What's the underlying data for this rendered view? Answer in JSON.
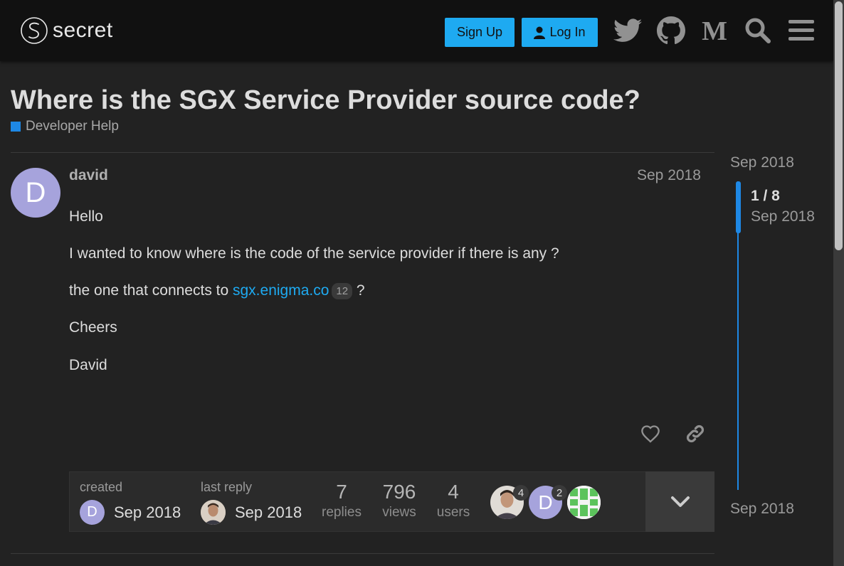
{
  "header": {
    "logo_text": "secret",
    "signup_label": "Sign Up",
    "login_label": "Log In",
    "icons": [
      "twitter-icon",
      "github-icon",
      "medium-icon",
      "search-icon",
      "hamburger-menu-icon"
    ]
  },
  "topic": {
    "title": "Where is the SGX Service Provider source code?",
    "category": "Developer Help",
    "category_color": "#1e88e5"
  },
  "post": {
    "avatar_letter": "D",
    "avatar_color": "#a6a3dc",
    "username": "david",
    "date": "Sep 2018",
    "p1": "Hello",
    "p2": "I wanted to know where is the code of the service provider if there is any ?",
    "p3_before": "the one that connects to ",
    "p3_link": "sgx.enigma.co",
    "p3_clicks": "12",
    "p3_after": " ?",
    "p4": "Cheers",
    "p5": "David"
  },
  "topic_map": {
    "created_label": "created",
    "created_avatar_letter": "D",
    "created_date": "Sep 2018",
    "last_reply_label": "last reply",
    "last_reply_date": "Sep 2018",
    "replies_count": "7",
    "replies_label": "replies",
    "views_count": "796",
    "views_label": "views",
    "users_count": "4",
    "users_label": "users",
    "participants": [
      {
        "badge": "4"
      },
      {
        "letter": "D",
        "badge": "2"
      },
      {}
    ]
  },
  "timeline": {
    "start_date": "Sep 2018",
    "position": "1 / 8",
    "position_date": "Sep 2018",
    "end_date": "Sep 2018"
  }
}
